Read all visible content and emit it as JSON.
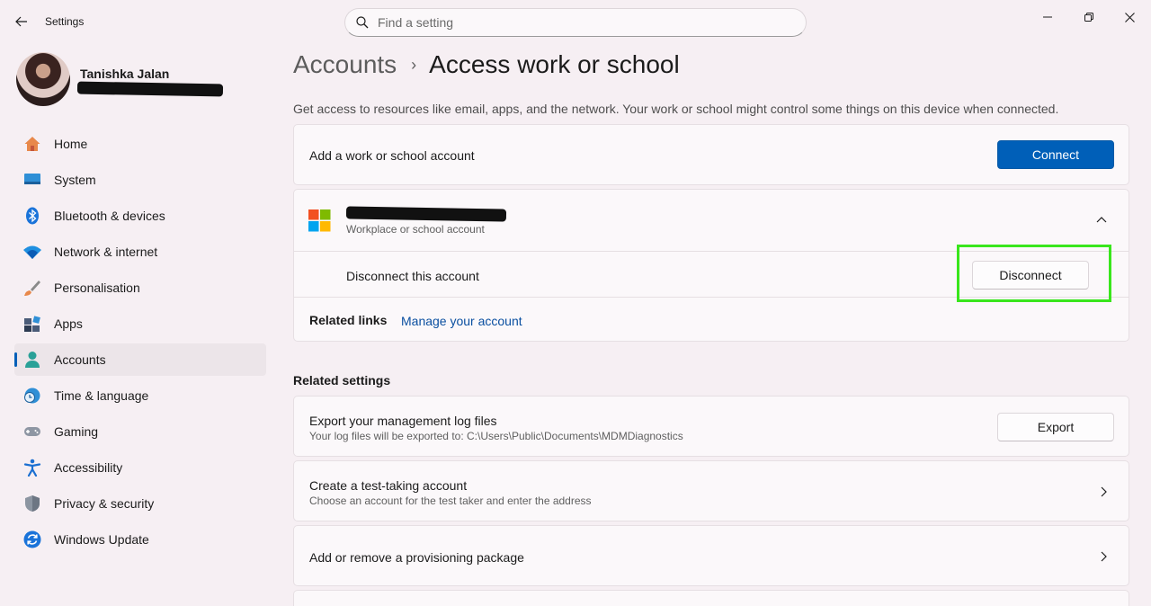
{
  "window": {
    "title": "Settings"
  },
  "search": {
    "placeholder": "Find a setting"
  },
  "profile": {
    "name": "Tanishka Jalan"
  },
  "nav": {
    "items": [
      {
        "label": "Home",
        "icon": "home-icon"
      },
      {
        "label": "System",
        "icon": "system-icon"
      },
      {
        "label": "Bluetooth & devices",
        "icon": "bluetooth-icon"
      },
      {
        "label": "Network & internet",
        "icon": "wifi-icon"
      },
      {
        "label": "Personalisation",
        "icon": "brush-icon"
      },
      {
        "label": "Apps",
        "icon": "apps-icon"
      },
      {
        "label": "Accounts",
        "icon": "accounts-icon",
        "active": true
      },
      {
        "label": "Time & language",
        "icon": "globe-clock-icon"
      },
      {
        "label": "Gaming",
        "icon": "gamepad-icon"
      },
      {
        "label": "Accessibility",
        "icon": "accessibility-icon"
      },
      {
        "label": "Privacy & security",
        "icon": "shield-icon"
      },
      {
        "label": "Windows Update",
        "icon": "update-icon"
      }
    ]
  },
  "breadcrumb": {
    "parent": "Accounts",
    "separator": "›",
    "current": "Access work or school"
  },
  "description": "Get access to resources like email, apps, and the network. Your work or school might control some things on this device when connected.",
  "add_account": {
    "label": "Add a work or school account",
    "button": "Connect"
  },
  "account": {
    "type": "Workplace or school account",
    "disconnect_label": "Disconnect this account",
    "disconnect_button": "Disconnect",
    "related_links_label": "Related links",
    "manage_link": "Manage your account"
  },
  "related_settings": {
    "title": "Related settings",
    "export": {
      "label": "Export your management log files",
      "sub": "Your log files will be exported to: C:\\Users\\Public\\Documents\\MDMDiagnostics",
      "button": "Export"
    },
    "test_account": {
      "label": "Create a test-taking account",
      "sub": "Choose an account for the test taker and enter the address"
    },
    "provisioning": {
      "label": "Add or remove a provisioning package"
    }
  },
  "colors": {
    "accent": "#005fb8",
    "highlight": "#39e61c",
    "background": "#f6eff3"
  }
}
